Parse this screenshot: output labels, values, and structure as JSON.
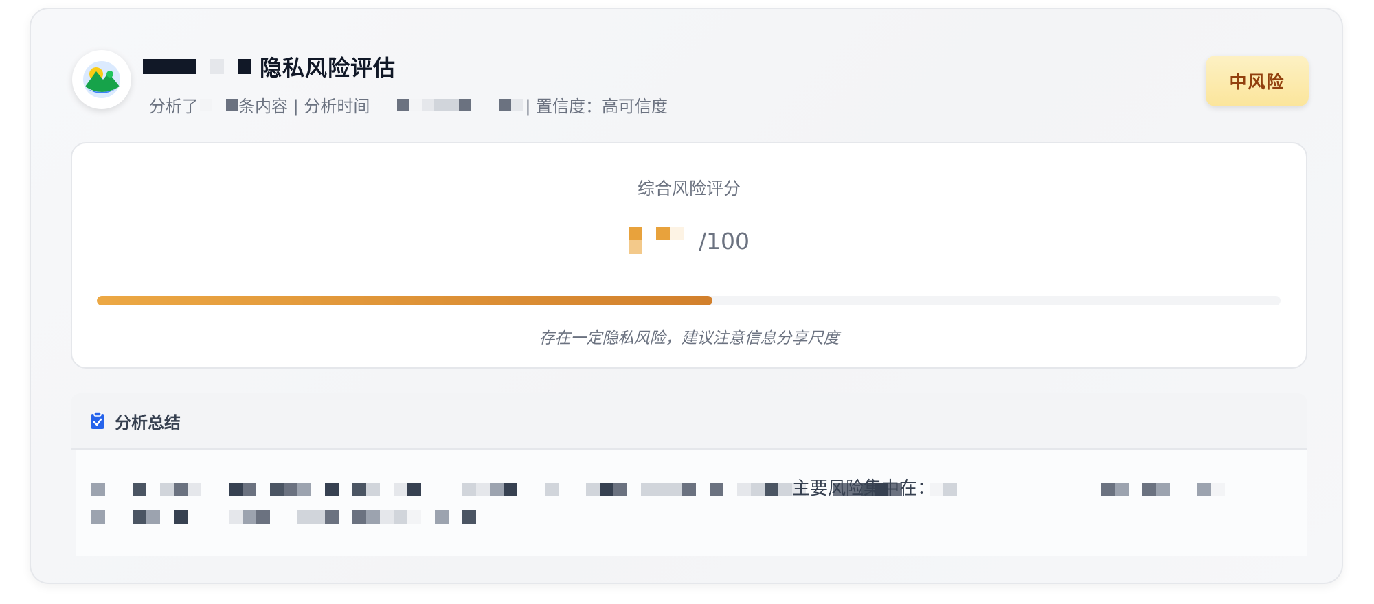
{
  "report": {
    "title": "隐私风险评估",
    "subtitle": {
      "analyzed_prefix": "分析了",
      "count_suffix": "条内容 | 分析时间",
      "confidence": "| 置信度：高可信度"
    },
    "risk_level": "中风险"
  },
  "score_panel": {
    "label": "综合风险评分",
    "max": "/100",
    "progress_fraction": 0.52,
    "note": "存在一定隐私风险，建议注意信息分享尺度"
  },
  "summary": {
    "title": "分析总结",
    "risk_focus_label": "主要风险集中在："
  },
  "colors": {
    "badge_text": "#92400e",
    "progress_start": "#eca844",
    "progress_end": "#d2802c",
    "summary_icon": "#2563eb"
  },
  "icons": {
    "avatar": "landscape-avatar-icon",
    "summary": "clipboard-check-icon"
  }
}
